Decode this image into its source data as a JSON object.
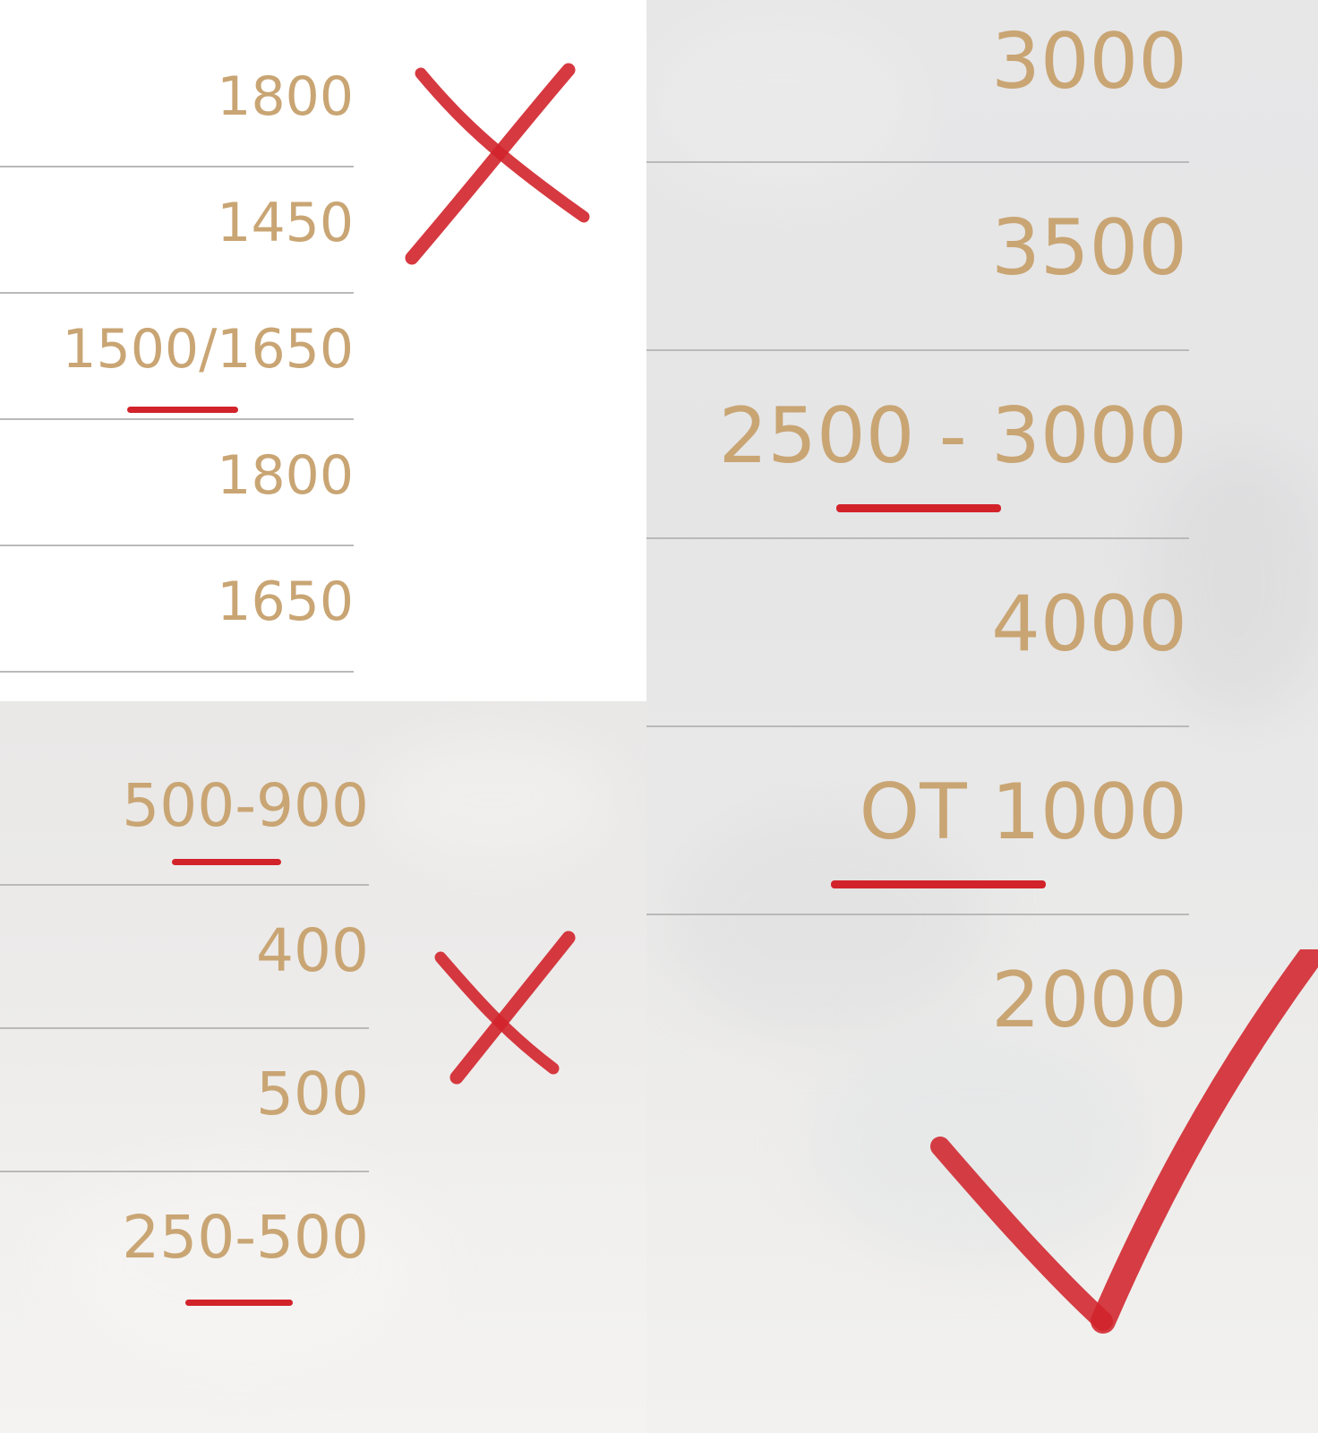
{
  "panels": {
    "top_left": {
      "prices": [
        "1800",
        "1450",
        "1500/1650",
        "1800",
        "1650"
      ]
    },
    "bottom_left": {
      "prices": [
        "500-900",
        "400",
        "500",
        "250-500"
      ]
    },
    "right": {
      "prices": [
        "3000",
        "3500",
        "2500 - 3000",
        "4000",
        "ОТ 1000",
        "2000"
      ]
    }
  },
  "marks": {
    "top_left": "cross-mark",
    "bottom_left": "cross-mark",
    "right": "check-mark"
  },
  "colors": {
    "price_text": "#c9a574",
    "divider": "#b9b9b9",
    "annotation_red": "#d2232b"
  }
}
